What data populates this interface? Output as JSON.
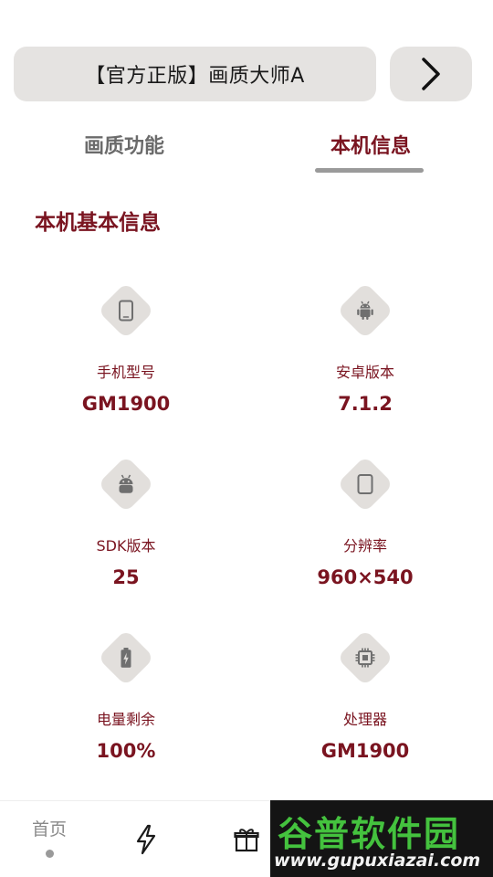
{
  "header": {
    "title": "【官方正版】画质大师A",
    "next_icon": "chevron-right-icon"
  },
  "tabs": [
    {
      "label": "画质功能",
      "active": false
    },
    {
      "label": "本机信息",
      "active": true
    }
  ],
  "section": {
    "title": "本机基本信息"
  },
  "info": [
    {
      "icon": "phone-icon",
      "label": "手机型号",
      "value": "GM1900"
    },
    {
      "icon": "android-icon",
      "label": "安卓版本",
      "value": "7.1.2"
    },
    {
      "icon": "android-head-icon",
      "label": "SDK版本",
      "value": "25"
    },
    {
      "icon": "screen-icon",
      "label": "分辨率",
      "value": "960×540"
    },
    {
      "icon": "battery-icon",
      "label": "电量剩余",
      "value": "100%"
    },
    {
      "icon": "chip-icon",
      "label": "处理器",
      "value": "GM1900"
    }
  ],
  "nav": {
    "home_label": "首页",
    "items": [
      "home-icon",
      "flash-icon",
      "gift-icon"
    ]
  },
  "watermark": {
    "top": "谷普软件园",
    "bottom": "www.gupuxiazai.com"
  },
  "colors": {
    "accent": "#7a1420",
    "chip_bg": "#e2dfdc",
    "header_bg": "#e5e3e1",
    "muted": "#8a8a8a"
  }
}
